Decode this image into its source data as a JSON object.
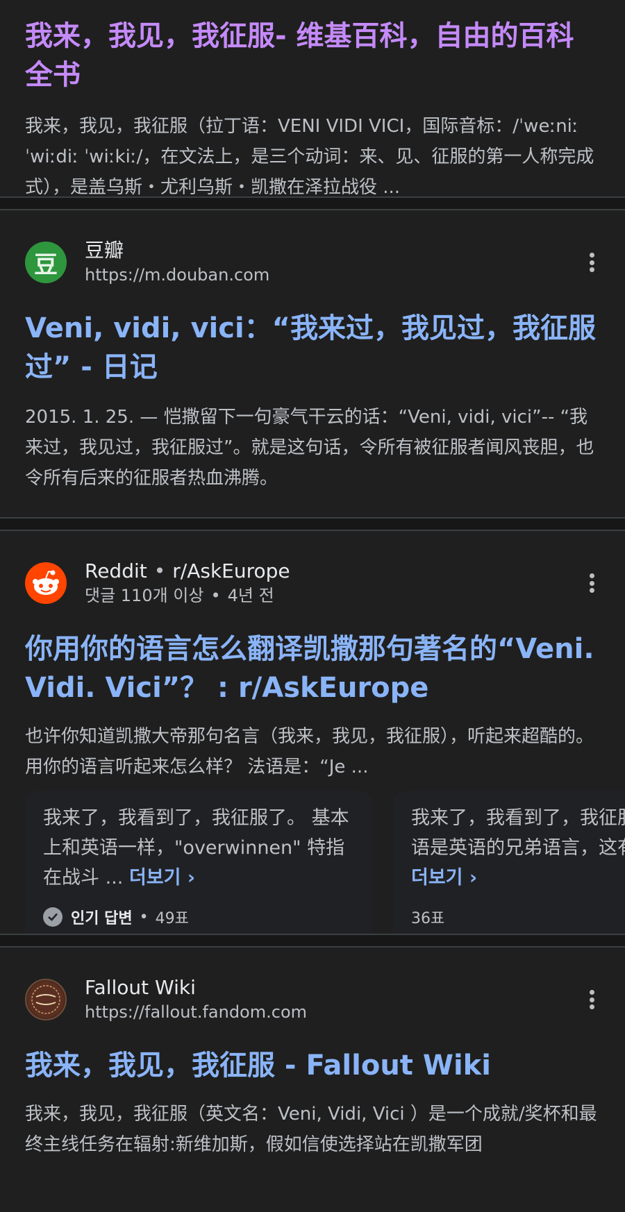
{
  "results": [
    {
      "title": "我来，我见，我征服- 维基百科，自由的百科全书",
      "snippet": "我来，我见，我征服（拉丁语：VENI VIDI VICI，国际音标：/ˈweːniː ˈwiːdiː ˈwiːkiː/，在文法上，是三个动词：来、见、征服的第一人称完成式），是盖乌斯・尤利乌斯・凯撒在泽拉战役 ..."
    },
    {
      "source_name": "豆瓣",
      "source_url": "https://m.douban.com",
      "favicon_char": "豆",
      "title": "Veni, vidi, vici：“我来过，我见过，我征服过” - 日记",
      "snippet": "2015. 1. 25. — 恺撒留下一句豪气干云的话：“Veni, vidi, vici”-- “我来过，我见过，我征服过”。就是这句话，令所有被征服者闻风丧胆，也令所有后来的征服者热血沸腾。"
    },
    {
      "source_name": "Reddit",
      "source_sub": "r/AskEurope",
      "source_meta": "댓글 110개 이상",
      "source_age": "4년 전",
      "title": "你用你的语言怎么翻译凯撒那句著名的“Veni. Vidi. Vici”？ : r/AskEurope",
      "snippet": "也许你知道凯撒大帝那句名言（我来，我见，我征服），听起来超酷的。用你的语言听起来怎么样？ 法语是：“Je ...",
      "cards": [
        {
          "text": "我来了，我看到了，我征服了。 基本上和英语一样，\"overwinnen\" 特指在战斗 ...",
          "more": "더보기",
          "badge": "인기 답변",
          "votes": "49표"
        },
        {
          "text": "我来了，我看到了，我征服了。荷兰语是英语的兄弟语言，这有点奇怪 ...",
          "more": "더보기",
          "votes": "36표"
        }
      ]
    },
    {
      "source_name": "Fallout Wiki",
      "source_url": "https://fallout.fandom.com",
      "title": "我来，我见，我征服 - Fallout Wiki",
      "snippet": "我来，我见，我征服（英文名：Veni, Vidi, Vici ）是一个成就/奖杯和最终主线任务在辐射:新维加斯，假如信使选择站在凯撒军团"
    }
  ],
  "colors": {
    "visited": "#c58af9",
    "link": "#8ab4f8",
    "douban": "#2e963d",
    "reddit": "#ff4500"
  },
  "icons": [
    "douban-icon",
    "reddit-icon",
    "fallout-wiki-icon",
    "more-vert-icon",
    "check-circle-icon",
    "chevron-right-icon"
  ]
}
